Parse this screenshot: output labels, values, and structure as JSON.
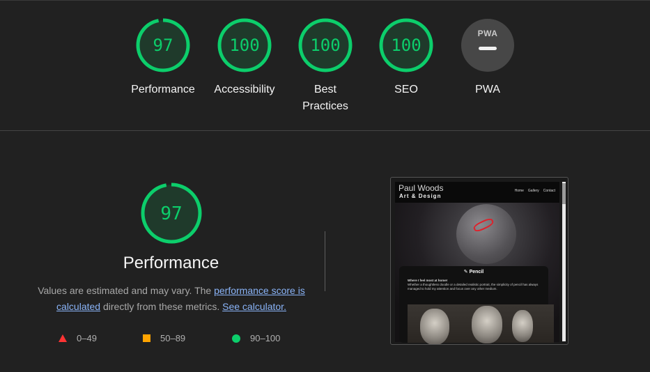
{
  "colors": {
    "pass": "#0cce6b",
    "average": "#ffa400",
    "fail": "#ff3333",
    "na": "#5f5f5f"
  },
  "categories": [
    {
      "label": "Performance",
      "score": 97,
      "fraction": 0.97
    },
    {
      "label": "Accessibility",
      "score": 100,
      "fraction": 1.0
    },
    {
      "label_line1": "Best",
      "label_line2": "Practices",
      "score": 100,
      "fraction": 1.0
    },
    {
      "label": "SEO",
      "score": 100,
      "fraction": 1.0
    },
    {
      "label": "PWA",
      "badge": "PWA",
      "icon": "dash-icon"
    }
  ],
  "performance": {
    "score": 97,
    "fraction": 0.97,
    "title": "Performance",
    "desc_part1": "Values are estimated and may vary. The ",
    "link_score": "performance score is calculated",
    "desc_part2": " directly from these metrics. ",
    "link_calc": "See calculator."
  },
  "legend": [
    {
      "icon": "triangle-icon",
      "range": "0–49"
    },
    {
      "icon": "square-icon",
      "range": "50–89"
    },
    {
      "icon": "circle-icon",
      "range": "90–100"
    }
  ],
  "screenshot": {
    "site_name": "Paul Woods",
    "site_sub": "Art & Design",
    "nav": [
      "Home",
      "Gallery",
      "Contact"
    ],
    "card_title": "✎ Pencil",
    "card_sub": "Where I feel most at home!",
    "card_body": "Whether a thoughtless doodle or a detailed realistic portrait, the simplicity of pencil has always managed to hold my attention and focus over any other medium."
  }
}
